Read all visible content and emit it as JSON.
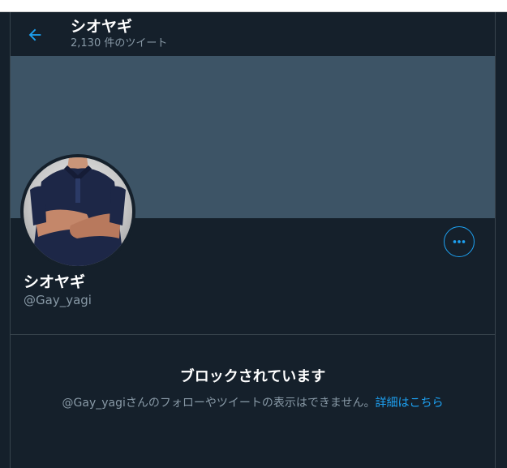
{
  "header": {
    "name": "シオヤギ",
    "tweet_count": "2,130 件のツイート"
  },
  "profile": {
    "display_name": "シオヤギ",
    "handle": "@Gay_yagi"
  },
  "blocked": {
    "title": "ブロックされています",
    "description": "@Gay_yagiさんのフォローやツイートの表示はできません。",
    "link_label": "詳細はこちら"
  },
  "icons": {
    "back": "arrow-left-icon",
    "more": "more-options-icon"
  },
  "colors": {
    "background": "#15202b",
    "banner": "#3d5466",
    "accent": "#1da1f2",
    "secondary_text": "#8899a6",
    "border": "#38444d"
  }
}
